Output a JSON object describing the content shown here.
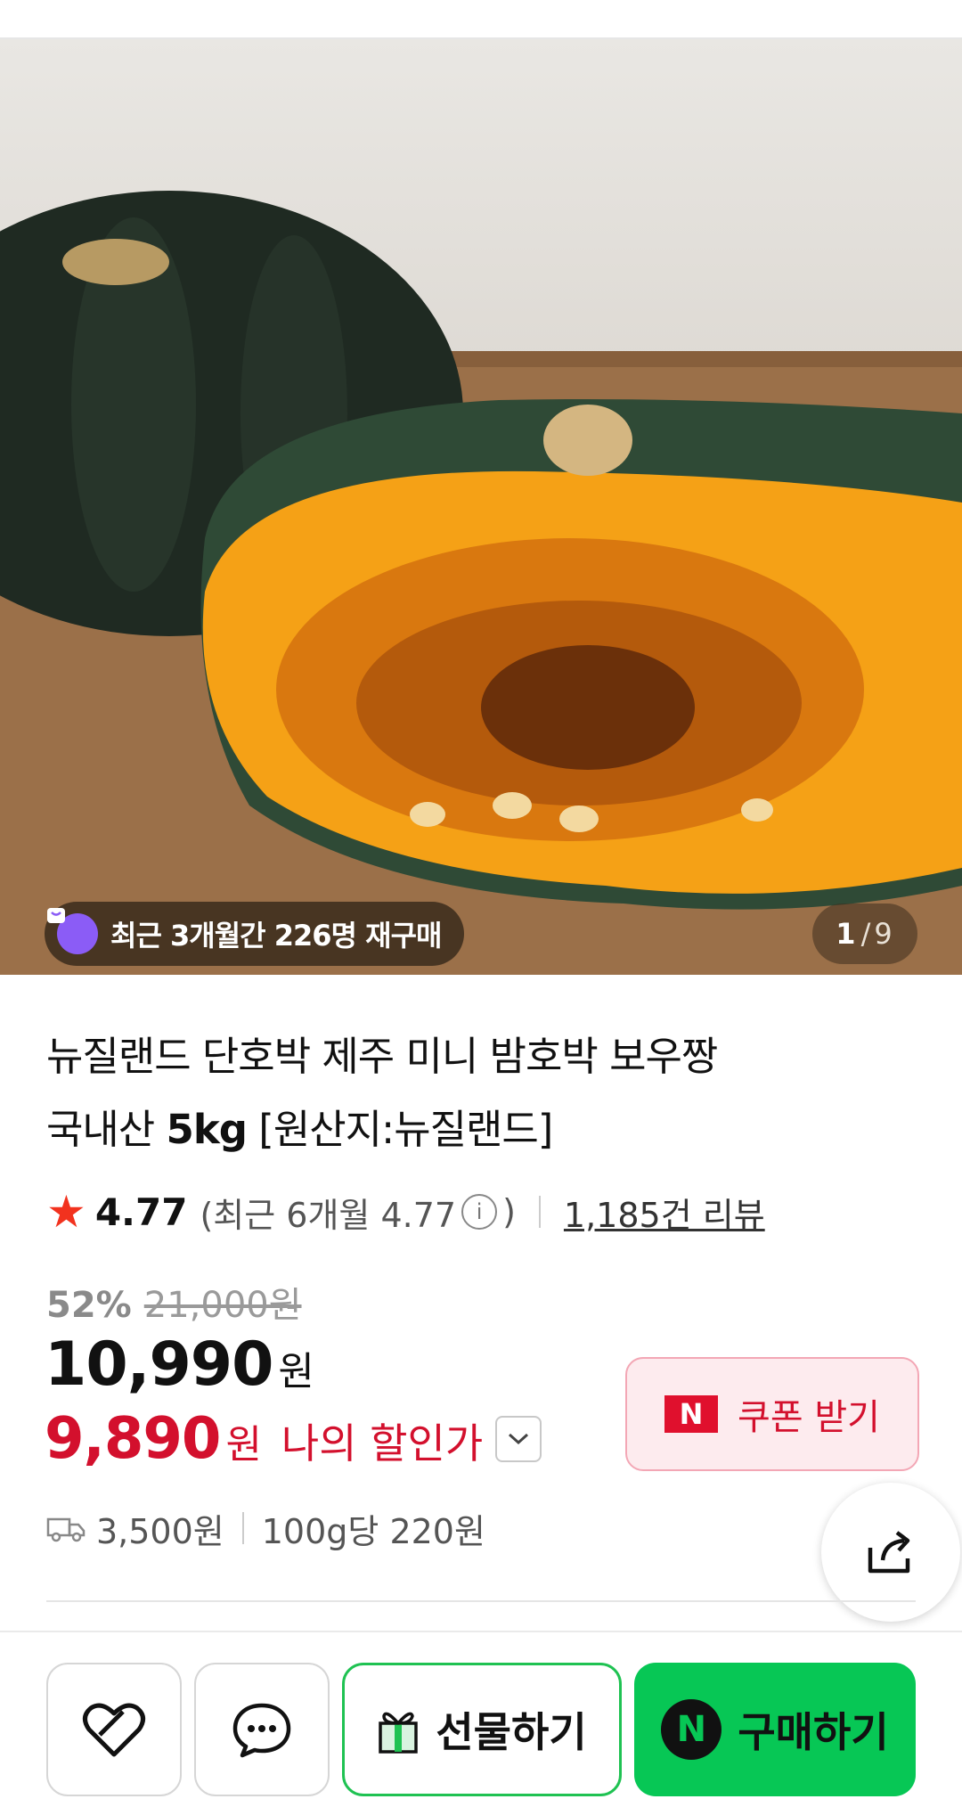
{
  "hero": {
    "repurchase_text": "최근 3개월간 226명 재구매",
    "image_index": "1",
    "image_separator": "/",
    "image_total": "9"
  },
  "product": {
    "title_line1": "뉴질랜드 단호박 제주 미니 밤호박 보우짱",
    "title_line2_prefix": "국내산 ",
    "title_line2_bold": "5kg",
    "title_line2_suffix": " [원산지:뉴질랜드]"
  },
  "rating": {
    "score": "4.77",
    "recent_prefix": "(최근 6개월 4.77",
    "recent_suffix": ")",
    "info_glyph": "i",
    "reviews": "1,185건 리뷰"
  },
  "pricing": {
    "discount_rate": "52%",
    "original_price": "21,000원",
    "price": "10,990",
    "currency": "원",
    "my_price": "9,890",
    "my_price_label": "나의 할인가"
  },
  "coupon": {
    "badge": "N",
    "label": "쿠폰 받기"
  },
  "shipping": {
    "fee": "3,500원",
    "unit_price": "100g당 220원"
  },
  "actions": {
    "gift_label": "선물하기",
    "buy_badge": "N",
    "buy_label": "구매하기"
  },
  "colors": {
    "accent_red": "#d3102d",
    "naver_green": "#07c755",
    "star": "#f2321e",
    "repurchase_bag": "#8b5cf6"
  }
}
